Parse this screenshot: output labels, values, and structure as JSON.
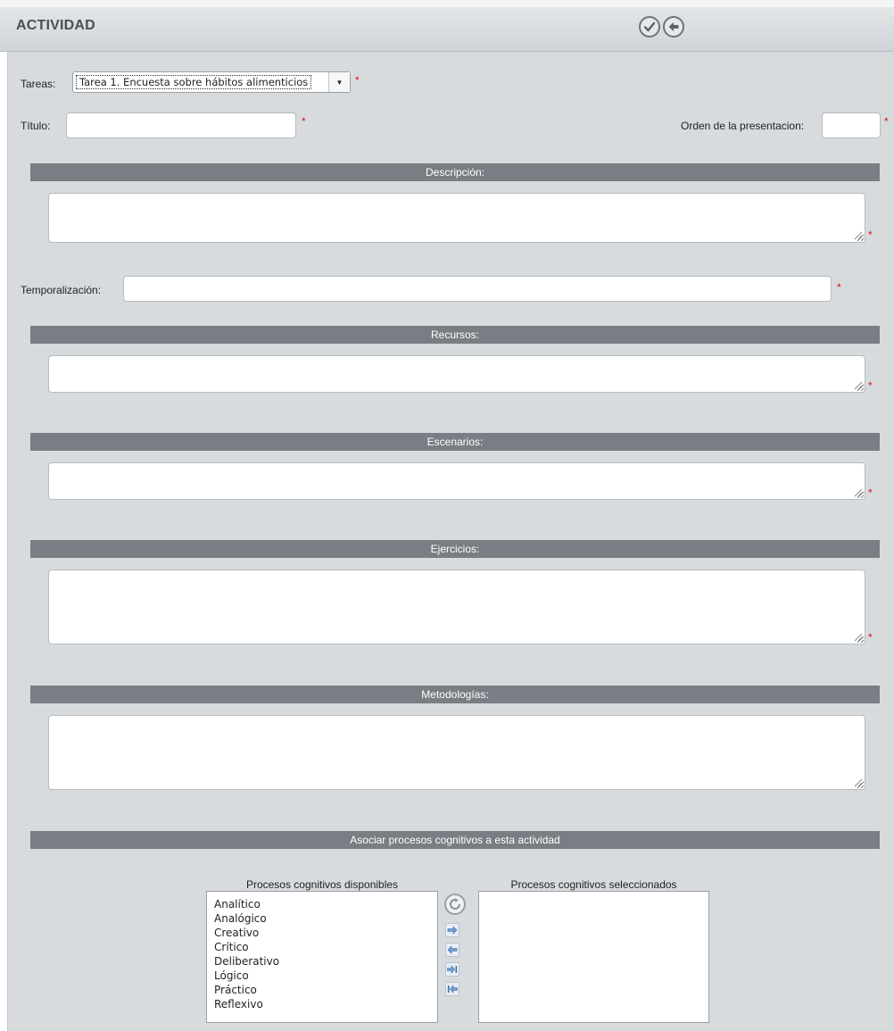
{
  "window": {
    "title": "ACTIVIDAD",
    "icons": [
      "check-circle-icon",
      "back-arrow-circle-icon"
    ]
  },
  "form": {
    "tareas": {
      "label": "Tareas:",
      "selected": "Tarea 1. Encuesta sobre hábitos alimenticios"
    },
    "titulo": {
      "label": "Título:",
      "value": ""
    },
    "orden": {
      "label": "Orden de la presentacion:",
      "value": ""
    },
    "descripcion": {
      "header": "Descripción:",
      "value": ""
    },
    "temporalizacion": {
      "label": "Temporalización:",
      "value": ""
    },
    "recursos": {
      "header": "Recursos:",
      "value": ""
    },
    "escenarios": {
      "header": "Escenarios:",
      "value": ""
    },
    "ejercicios": {
      "header": "Ejercicios:",
      "value": ""
    },
    "metodologias": {
      "header": "Metodologías:",
      "value": ""
    },
    "required_mark": "*"
  },
  "procesos": {
    "header": "Asociar procesos cognitivos a esta actividad",
    "available_title": "Procesos cognitivos disponibles",
    "selected_title": "Procesos cognitivos seleccionados",
    "available": [
      "Analítico",
      "Analógico",
      "Creativo",
      "Crítico",
      "Deliberativo",
      "Lógico",
      "Práctico",
      "Reflexivo"
    ],
    "selected": [],
    "buttons": [
      "refresh-icon",
      "move-right-icon",
      "move-left-icon",
      "move-all-right-icon",
      "move-all-left-icon"
    ]
  },
  "colors": {
    "panel_bg": "#d7dbde",
    "section_bar": "#787e83",
    "required": "#e01010"
  }
}
